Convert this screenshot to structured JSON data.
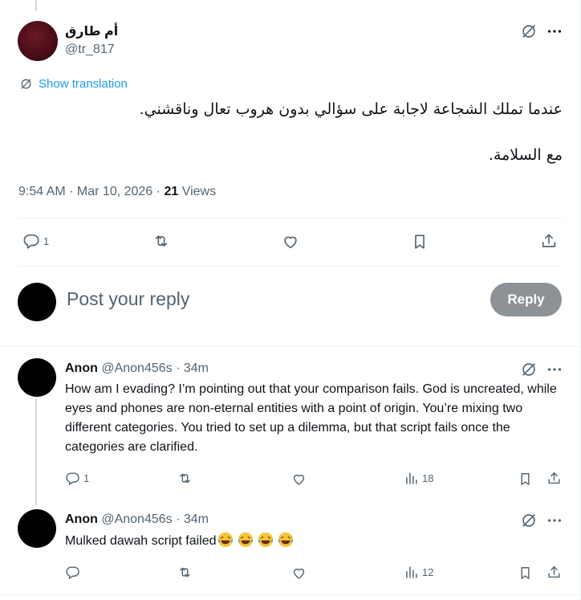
{
  "tweet": {
    "author_name": "أم طارق",
    "author_handle": "@tr_817",
    "show_translation": "Show translation",
    "text_line1": "عندما تملك الشجاعة لاجابة على سؤالي بدون هروب تعال وناقشني.",
    "text_line2": "مع السلامة.",
    "time": "9:54 AM · Mar 10, 2026 ·",
    "views_count": "21",
    "views_label": "Views",
    "reply_count": "1"
  },
  "composer": {
    "placeholder": "Post your reply",
    "reply_button": "Reply"
  },
  "comments": [
    {
      "name": "Anon",
      "handle": "@Anon456s",
      "time": "· 34m",
      "text": "How am I evading? I’m pointing out that your comparison fails. God is uncreated, while eyes and phones are non-eternal entities with a point of origin. You’re mixing two different categories. You tried to set up a dilemma, but that script fails once the categories are clarified.",
      "reply_count": "1",
      "views_count": "18"
    },
    {
      "name": "Anon",
      "handle": "@Anon456s",
      "time": "· 34m",
      "text": "Mulked  dawah script failed",
      "emoji_count": 4,
      "views_count": "12"
    }
  ],
  "icons": {
    "more": "more-icon",
    "grok": "grok-icon",
    "reply": "reply-icon",
    "retweet": "retweet-icon",
    "like": "like-icon",
    "bookmark": "bookmark-icon",
    "share": "share-icon",
    "views": "views-icon",
    "emoji": "laughing-crying-emoji"
  },
  "colors": {
    "accent": "#1d9bf0",
    "secondary_text": "#536471",
    "reply_button_disabled": "#8d9297",
    "avatar_main": "#4a0d17"
  }
}
